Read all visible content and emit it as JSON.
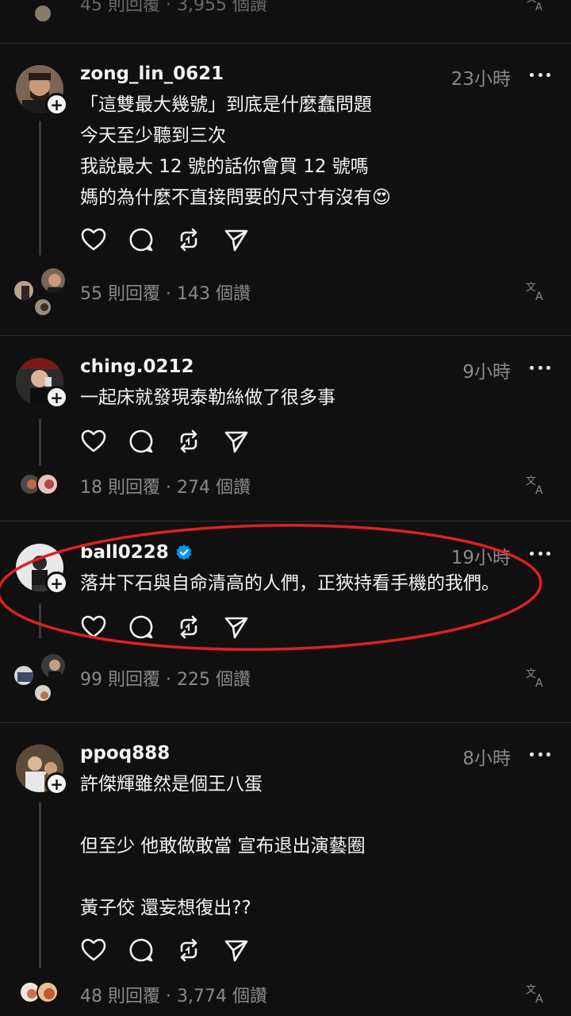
{
  "top_partial": {
    "stats": "45 則回覆 · 3,955 個讚"
  },
  "posts": [
    {
      "username": "zong_lin_0621",
      "time": "23小時",
      "verified": false,
      "lines": [
        "「這雙最大幾號」到底是什麼蠢問題",
        "今天至少聽到三次",
        "我說最大 12 號的話你會買 12 號嗎",
        "媽的為什麼不直接問要的尺寸有沒有😍"
      ],
      "stats": "55 則回覆 · 143 個讚"
    },
    {
      "username": "ching.0212",
      "time": "9小時",
      "verified": false,
      "lines": [
        "一起床就發現泰勒絲做了很多事"
      ],
      "stats": "18 則回覆 · 274 個讚"
    },
    {
      "username": "ball0228",
      "time": "19小時",
      "verified": true,
      "lines": [
        "落井下石與自命清高的人們，正狹持看手機的我們。"
      ],
      "stats": "99 則回覆 · 225 個讚"
    },
    {
      "username": "ppoq888",
      "time": "8小時",
      "verified": false,
      "lines": [
        "許傑輝雖然是個王八蛋",
        "",
        "但至少 他敢做敢當 宣布退出演藝圈",
        "",
        "黃子佼 還妄想復出??"
      ],
      "stats": "48 則回覆 · 3,774 個讚"
    }
  ],
  "colors": {
    "background": "#101010",
    "text": "#f3f3f3",
    "muted": "#8a8a8a",
    "verified": "#0095f6",
    "highlight": "#e02020"
  },
  "icons": [
    "heart-icon",
    "comment-icon",
    "repost-icon",
    "share-icon",
    "translate-icon",
    "more-icon",
    "follow-plus-icon",
    "verified-icon"
  ]
}
